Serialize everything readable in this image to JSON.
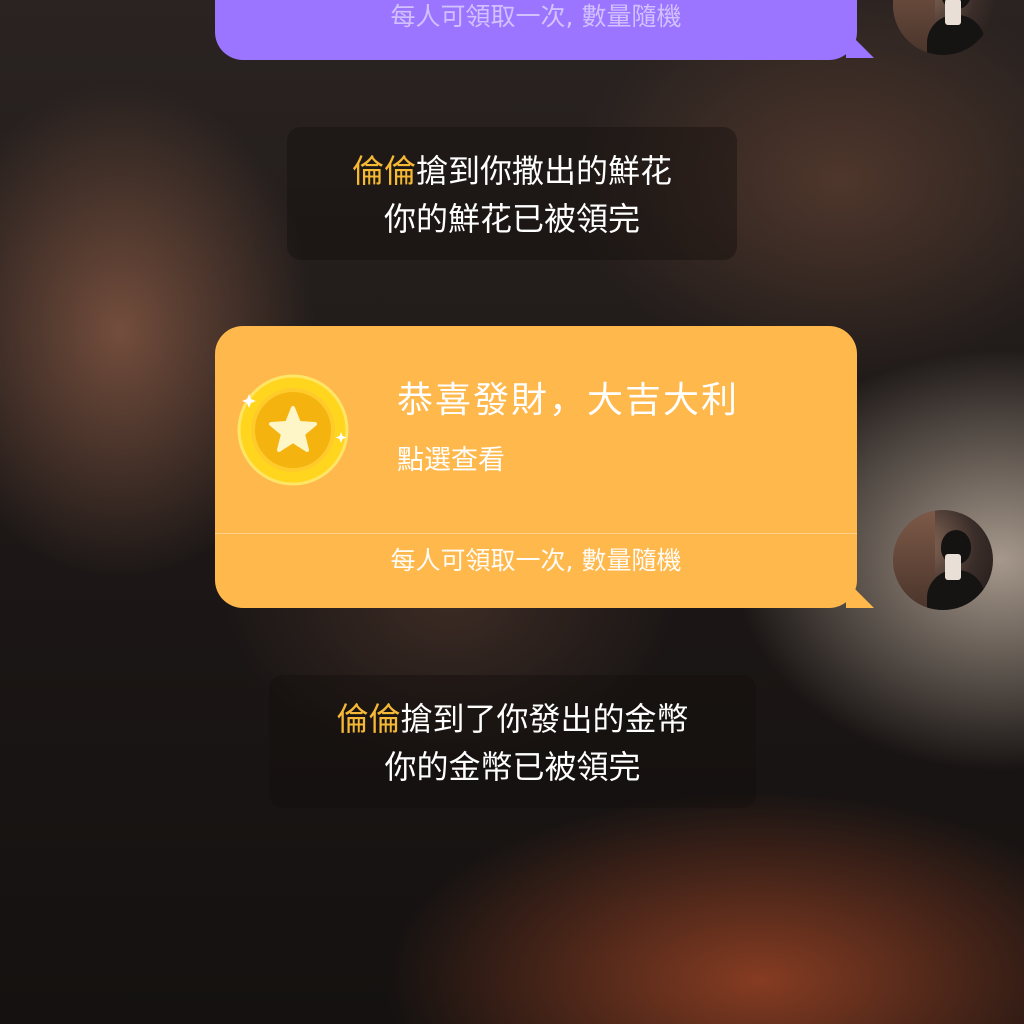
{
  "top_bubble": {
    "footer": "每人可領取一次, 數量隨機",
    "color": "#9b74ff"
  },
  "notice_flower": {
    "name": "倫倫",
    "line1_rest": "搶到你撒出的鮮花",
    "line2": "你的鮮花已被領完"
  },
  "red_packet": {
    "title": "恭喜發財，大吉大利",
    "subtitle": "點選查看",
    "footer": "每人可領取一次, 數量隨機",
    "color": "#ffb84c",
    "icon": "gold-star-coin-icon"
  },
  "notice_coin": {
    "name": "倫倫",
    "line1_rest": "搶到了你發出的金幣",
    "line2": "你的金幣已被領完"
  },
  "colors": {
    "name_highlight": "#f5b935"
  }
}
